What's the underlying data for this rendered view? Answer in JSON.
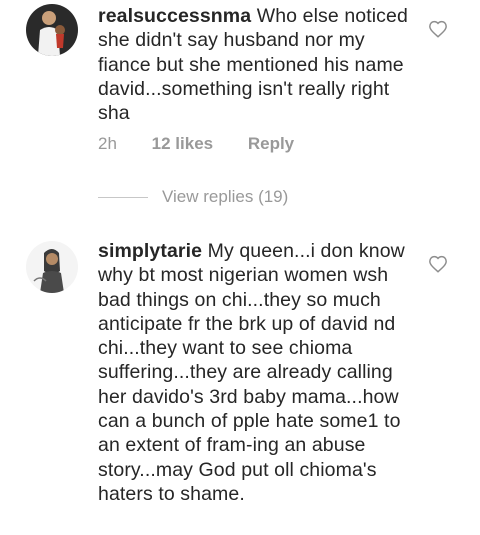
{
  "comments": [
    {
      "username": "realsuccessnma",
      "text": "Who else noticed she didn't say husband nor my fiance but she mentioned his name david...something isn't really right sha",
      "time": "2h",
      "likes": "12 likes",
      "reply": "Reply",
      "view_replies": "View replies (19)"
    },
    {
      "username": "simplytarie",
      "text": "My queen...i don know why bt most nigerian women wsh bad things on chi...they so much anticipate fr the brk up of david nd chi...they want to see chioma suffering...they are already calling her davido's 3rd baby mama...how can a bunch of pple hate some1 to an extent of fram-ing an abuse story...may God put oll chioma's haters to shame."
    }
  ],
  "colors": {
    "text": "#262626",
    "secondary": "#999999",
    "divider": "#c7c7c7"
  },
  "icons": [
    "heart-outline-icon"
  ]
}
